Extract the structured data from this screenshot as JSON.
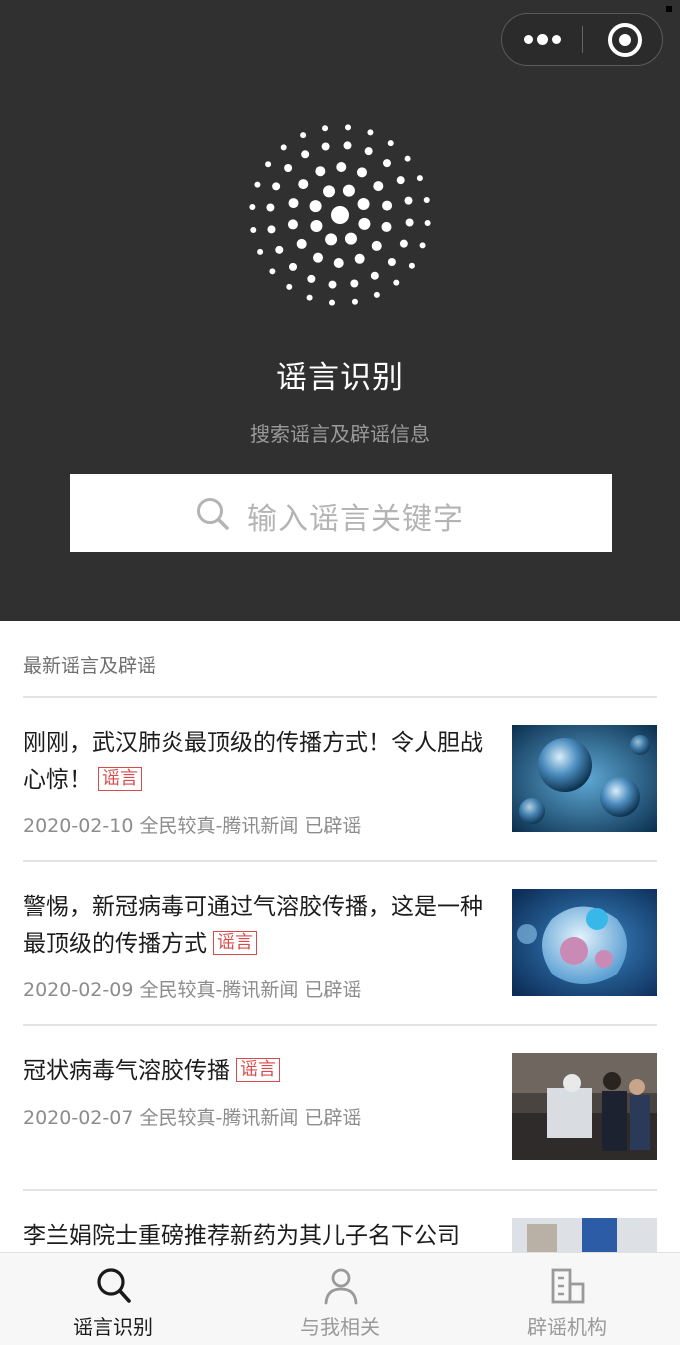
{
  "app": {
    "title": "谣言识别",
    "subtitle": "搜索谣言及辟谣信息"
  },
  "search": {
    "placeholder": "输入谣言关键字"
  },
  "section": {
    "title": "最新谣言及辟谣"
  },
  "articles": [
    {
      "title": "刚刚，武汉肺炎最顶级的传播方式！令人胆战心惊！",
      "badge": "谣言",
      "meta": "2020-02-10  全民较真-腾讯新闻  已辟谣"
    },
    {
      "title": "警惕，新冠病毒可通过气溶胶传播，这是一种最顶级的传播方式",
      "badge": "谣言",
      "meta": "2020-02-09  全民较真-腾讯新闻  已辟谣"
    },
    {
      "title": "冠状病毒气溶胶传播",
      "badge": "谣言",
      "meta": "2020-02-07  全民较真-腾讯新闻  已辟谣"
    },
    {
      "title": "李兰娟院士重磅推荐新药为其儿子名下公司"
    }
  ],
  "tabs": [
    {
      "label": "谣言识别",
      "icon": "search-icon",
      "active": true
    },
    {
      "label": "与我相关",
      "icon": "person-icon",
      "active": false
    },
    {
      "label": "辟谣机构",
      "icon": "building-icon",
      "active": false
    }
  ],
  "colors": {
    "header_bg": "#303030",
    "badge": "#d94a4a",
    "tab_active": "#1a1a1a",
    "tab_inactive": "#9a9a9a"
  }
}
